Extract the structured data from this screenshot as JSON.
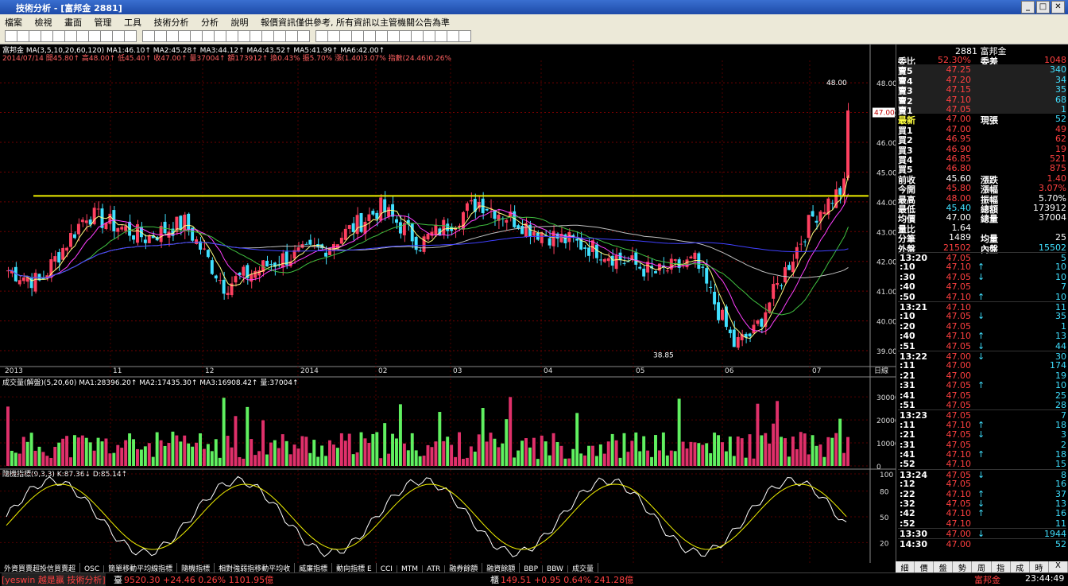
{
  "window": {
    "title": "技術分析 - [富邦金 2881]"
  },
  "menu": [
    "檔案",
    "檢視",
    "畫面",
    "管理",
    "工具",
    "技術分析",
    "分析",
    "說明",
    "報價資訊僅供參考, 所有資訊以主管機關公告為準"
  ],
  "info": {
    "line1": "富邦金 MA(3,5,10,20,60,120) MA1:46.10↑ MA2:45.28↑ MA3:44.12↑ MA4:43.52↑ MA5:41.99↑ MA6:42.00↑",
    "line2": "2014/07/14 開45.80↑ 高48.00↑ 低45.40↑ 收47.00↑ 量37004↑ 額173912↑ 換0.43% 振5.70% 漲(1.40)3.07% 指數(24.46)0.26%"
  },
  "price_axis": [
    "48.00",
    "47.00",
    "46.00",
    "45.00",
    "44.00",
    "43.00",
    "42.00",
    "41.00",
    "40.00",
    "39.00"
  ],
  "price_marks": {
    "high": "48.00",
    "low": "38.85",
    "current": "47.00"
  },
  "date_axis": [
    "2013",
    "11",
    "12",
    "2014",
    "02",
    "03",
    "04",
    "05",
    "06",
    "07",
    "日線"
  ],
  "vol": {
    "title": "成交量(解盤)(5,20,60) MA1:28396.20↑ MA2:17435.30↑ MA3:16908.42↑ 量:37004↑",
    "axis": [
      "30000",
      "20000",
      "10000",
      "0"
    ]
  },
  "kd": {
    "title": "隨機指標(9,3,3) K:87.36↓ D:85.14↑",
    "axis": [
      "100",
      "80",
      "50",
      "20"
    ]
  },
  "quote": {
    "header": "2881 富邦金",
    "ratio": {
      "l": "委比",
      "v": "52.30%",
      "l2": "委差",
      "v2": "1048"
    },
    "asks": [
      {
        "l": "賣5",
        "p": "47.25",
        "q": "340"
      },
      {
        "l": "賣4",
        "p": "47.20",
        "q": "34"
      },
      {
        "l": "賣3",
        "p": "47.15",
        "q": "35"
      },
      {
        "l": "賣2",
        "p": "47.10",
        "q": "68"
      },
      {
        "l": "賣1",
        "p": "47.05",
        "q": "1"
      }
    ],
    "last": {
      "l": "最新",
      "p": "47.00",
      "l2": "現張",
      "q": "52"
    },
    "bids": [
      {
        "l": "買1",
        "p": "47.00",
        "q": "49"
      },
      {
        "l": "買2",
        "p": "46.95",
        "q": "62"
      },
      {
        "l": "買3",
        "p": "46.90",
        "q": "19"
      },
      {
        "l": "買4",
        "p": "46.85",
        "q": "521"
      },
      {
        "l": "買5",
        "p": "46.80",
        "q": "875"
      }
    ],
    "stats": [
      {
        "l": "前收",
        "v": "45.60",
        "l2": "漲跌",
        "v2": "1.40"
      },
      {
        "l": "今開",
        "v": "45.80",
        "l2": "漲幅",
        "v2": "3.07%"
      },
      {
        "l": "最高",
        "v": "48.00",
        "l2": "振幅",
        "v2": "5.70%"
      },
      {
        "l": "最低",
        "v": "45.40",
        "l2": "總額",
        "v2": "173912"
      },
      {
        "l": "均價",
        "v": "47.00",
        "l2": "總量",
        "v2": "37004"
      },
      {
        "l": "量比",
        "v": "1.64",
        "l2": "",
        "v2": ""
      },
      {
        "l": "分筆",
        "v": "1489",
        "l2": "均量",
        "v2": "25"
      },
      {
        "l": "外盤",
        "v": "21502",
        "l2": "內盤",
        "v2": "15502"
      }
    ],
    "ticks": [
      {
        "t": "13:20",
        "p": "47.05",
        "a": "",
        "q": "5",
        "c": "red"
      },
      {
        "t": ":10",
        "p": "47.10",
        "a": "↑",
        "q": "10",
        "c": "red"
      },
      {
        "t": ":30",
        "p": "47.05",
        "a": "↓",
        "q": "10",
        "c": "red"
      },
      {
        "t": ":40",
        "p": "47.05",
        "a": "",
        "q": "7",
        "c": "red"
      },
      {
        "t": ":50",
        "p": "47.10",
        "a": "↑",
        "q": "10",
        "c": "red"
      },
      {
        "t": "13:21",
        "p": "47.10",
        "a": "",
        "q": "11",
        "c": "red"
      },
      {
        "t": ":10",
        "p": "47.05",
        "a": "↓",
        "q": "35",
        "c": "red"
      },
      {
        "t": ":20",
        "p": "47.05",
        "a": "",
        "q": "1",
        "c": "red"
      },
      {
        "t": ":40",
        "p": "47.10",
        "a": "↑",
        "q": "13",
        "c": "red"
      },
      {
        "t": ":51",
        "p": "47.05",
        "a": "↓",
        "q": "44",
        "c": "red"
      },
      {
        "t": "13:22",
        "p": "47.00",
        "a": "↓",
        "q": "30",
        "c": "red"
      },
      {
        "t": ":11",
        "p": "47.00",
        "a": "",
        "q": "174",
        "c": "red"
      },
      {
        "t": ":21",
        "p": "47.00",
        "a": "",
        "q": "19",
        "c": "red"
      },
      {
        "t": ":31",
        "p": "47.05",
        "a": "↑",
        "q": "10",
        "c": "red"
      },
      {
        "t": ":41",
        "p": "47.05",
        "a": "",
        "q": "25",
        "c": "red"
      },
      {
        "t": ":51",
        "p": "47.05",
        "a": "",
        "q": "28",
        "c": "red"
      },
      {
        "t": "13:23",
        "p": "47.05",
        "a": "",
        "q": "7",
        "c": "red"
      },
      {
        "t": ":11",
        "p": "47.10",
        "a": "↑",
        "q": "18",
        "c": "red"
      },
      {
        "t": ":21",
        "p": "47.05",
        "a": "↓",
        "q": "3",
        "c": "red"
      },
      {
        "t": ":31",
        "p": "47.05",
        "a": "",
        "q": "2",
        "c": "red"
      },
      {
        "t": ":41",
        "p": "47.10",
        "a": "↑",
        "q": "18",
        "c": "red"
      },
      {
        "t": ":52",
        "p": "47.10",
        "a": "",
        "q": "15",
        "c": "red"
      },
      {
        "t": "13:24",
        "p": "47.05",
        "a": "↓",
        "q": "8",
        "c": "red"
      },
      {
        "t": ":12",
        "p": "47.05",
        "a": "",
        "q": "16",
        "c": "red"
      },
      {
        "t": ":22",
        "p": "47.10",
        "a": "↑",
        "q": "37",
        "c": "red"
      },
      {
        "t": ":32",
        "p": "47.05",
        "a": "↓",
        "q": "13",
        "c": "red"
      },
      {
        "t": ":42",
        "p": "47.10",
        "a": "↑",
        "q": "16",
        "c": "red"
      },
      {
        "t": ":52",
        "p": "47.10",
        "a": "",
        "q": "11",
        "c": "red"
      },
      {
        "t": "13:30",
        "p": "47.00",
        "a": "↓",
        "q": "1944",
        "c": "red"
      },
      {
        "t": "14:30",
        "p": "47.00",
        "a": "",
        "q": "52",
        "c": "red"
      }
    ]
  },
  "bottom_tabs": [
    "外資買賣超投信買賣超",
    "OSC",
    "簡單移動平均線指標",
    "隨機指標",
    "相對強弱指移動平均收",
    "威廉指標",
    "動向指標 E",
    "CCI",
    "MTM",
    "ATR",
    "融券餘額",
    "融資餘額",
    "BBP",
    "BBW",
    "成交量"
  ],
  "right_tabs": [
    "細",
    "價",
    "盤",
    "勢",
    "周",
    "指",
    "成",
    "時",
    "X"
  ],
  "status": {
    "brand": "[yeswin 越是贏 技術分析]",
    "idx1_label": "臺",
    "idx1": "9520.30 +24.46 0.26% 1101.95億",
    "idx2_label": "櫃",
    "idx2": "149.51 +0.95 0.64% 241.28億",
    "stock": "富邦金",
    "time": "23:44:49"
  },
  "colors": {
    "up": "#ff4060",
    "down": "#40e0ff",
    "vol_up": "#e0306a",
    "vol_dn": "#60f060",
    "yellow": "#f0f000"
  }
}
